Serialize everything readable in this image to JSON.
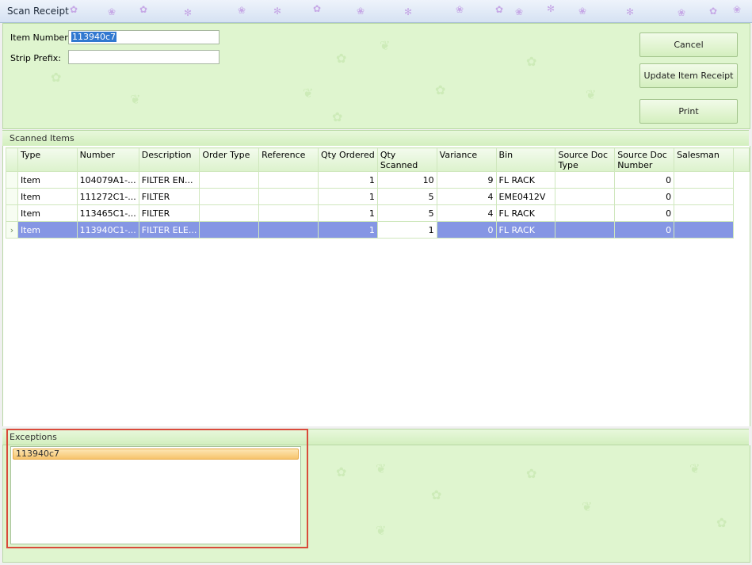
{
  "window": {
    "title": "Scan Receipt"
  },
  "form": {
    "item_number_label": "Item Number:",
    "item_number_value": "113940c7",
    "strip_prefix_label": "Strip Prefix:",
    "strip_prefix_value": ""
  },
  "buttons": {
    "cancel": "Cancel",
    "update": "Update Item Receipt",
    "print": "Print"
  },
  "scanned_items": {
    "header": "Scanned Items",
    "columns": [
      "Type",
      "Number",
      "Description",
      "Order Type",
      "Reference",
      "Qty Ordered",
      "Qty Scanned",
      "Variance",
      "Bin",
      "Source Doc Type",
      "Source Doc Number",
      "Salesman"
    ],
    "rows": [
      [
        "Item",
        "104079A1-...",
        "FILTER  EN...",
        "",
        "",
        "1",
        "10",
        "9",
        "FL RACK",
        "",
        "0",
        ""
      ],
      [
        "Item",
        "111272C1-...",
        "FILTER",
        "",
        "",
        "1",
        "5",
        "4",
        "EME0412V",
        "",
        "0",
        ""
      ],
      [
        "Item",
        "113465C1-...",
        "FILTER",
        "",
        "",
        "1",
        "5",
        "4",
        "FL RACK",
        "",
        "0",
        ""
      ],
      [
        "Item",
        "113940C1-...",
        "FILTER  ELE...",
        "",
        "",
        "1",
        "1",
        "0",
        "FL RACK",
        "",
        "0",
        ""
      ]
    ],
    "selected_row": 3,
    "row_indicator": "›"
  },
  "exceptions": {
    "header": "Exceptions",
    "items": [
      "113940c7"
    ]
  },
  "colors": {
    "panel": "#dff5cf",
    "selected_row": "#8596e4",
    "highlight_border": "#d94a3a"
  }
}
